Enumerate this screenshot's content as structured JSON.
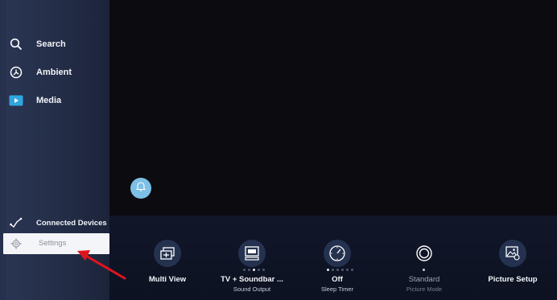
{
  "sidebar": {
    "items": [
      {
        "label": "Search",
        "icon": "search-icon"
      },
      {
        "label": "Ambient",
        "icon": "ambient-icon"
      },
      {
        "label": "Media",
        "icon": "media-play-icon"
      }
    ],
    "connected_devices_label": "Connected Devices",
    "settings_label": "Settings"
  },
  "quick_settings": [
    {
      "label": "Multi View",
      "sub": "",
      "icon": "multi-view-icon"
    },
    {
      "label": "TV + Soundbar ...",
      "sub": "Sound Output",
      "icon": "tv-soundbar-icon"
    },
    {
      "label": "Off",
      "sub": "Sleep Timer",
      "icon": "sleep-timer-icon"
    },
    {
      "label": "Standard",
      "sub": "Picture Mode",
      "icon": "picture-mode-icon"
    },
    {
      "label": "Picture Setup",
      "sub": "",
      "icon": "picture-setup-icon"
    }
  ],
  "colors": {
    "sidebar": "#2a3553",
    "quickbar": "#111629",
    "notification_button": "#7dbfe6",
    "arrow": "#e0141e"
  }
}
